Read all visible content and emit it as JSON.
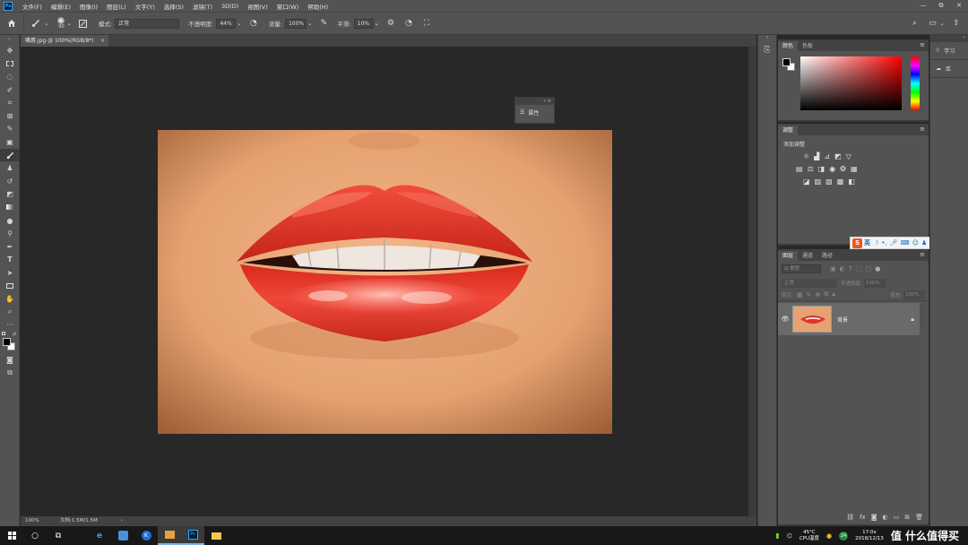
{
  "menubar": {
    "logo": "Ps",
    "items": [
      "文件(F)",
      "编辑(E)",
      "图像(I)",
      "图层(L)",
      "文字(Y)",
      "选择(S)",
      "滤镜(T)",
      "3D(D)",
      "视图(V)",
      "窗口(W)",
      "帮助(H)"
    ],
    "window_controls": [
      "—",
      "⧉",
      "✕"
    ]
  },
  "options": {
    "brush_size": "90",
    "mode_label": "模式:",
    "mode_value": "正常",
    "opacity_label": "不透明度:",
    "opacity_value": "44%",
    "flow_label": "流量:",
    "flow_value": "100%",
    "smooth_label": "平滑:",
    "smooth_value": "10%"
  },
  "document": {
    "tab_title": "嘴唇.jpg @ 100%(RGB/8*)",
    "tab_close": "×"
  },
  "properties_panel": {
    "label": "属性"
  },
  "status": {
    "zoom": "100%",
    "doc_info": "文档:1.5M/1.5M"
  },
  "color_panel": {
    "tabs": [
      "颜色",
      "色板"
    ]
  },
  "adjust_panel": {
    "tab": "调整",
    "add_label": "添加调整"
  },
  "layers_panel": {
    "tabs": [
      "图层",
      "通道",
      "路径"
    ],
    "kind_placeholder": "Q 类型",
    "blend_mode": "正常",
    "opacity_label": "不透明度:",
    "opacity_value": "100%",
    "lock_label": "锁定:",
    "fill_label": "填充:",
    "fill_value": "100%",
    "layer_name": "背景"
  },
  "learn": {
    "items": [
      "学习",
      "库"
    ]
  },
  "ime": {
    "logo": "S",
    "lang": "英"
  },
  "taskbar": {
    "temperature": "45°C",
    "cpu_label": "CPU温度",
    "time": "17:0x",
    "date": "2018/12/13",
    "badge": "24",
    "watermark": "值 什么值得买"
  },
  "colors": {
    "ui_bg": "#535353",
    "workspace": "#282828",
    "accent": "#31a8ff",
    "lip_red": "#e8352a"
  }
}
